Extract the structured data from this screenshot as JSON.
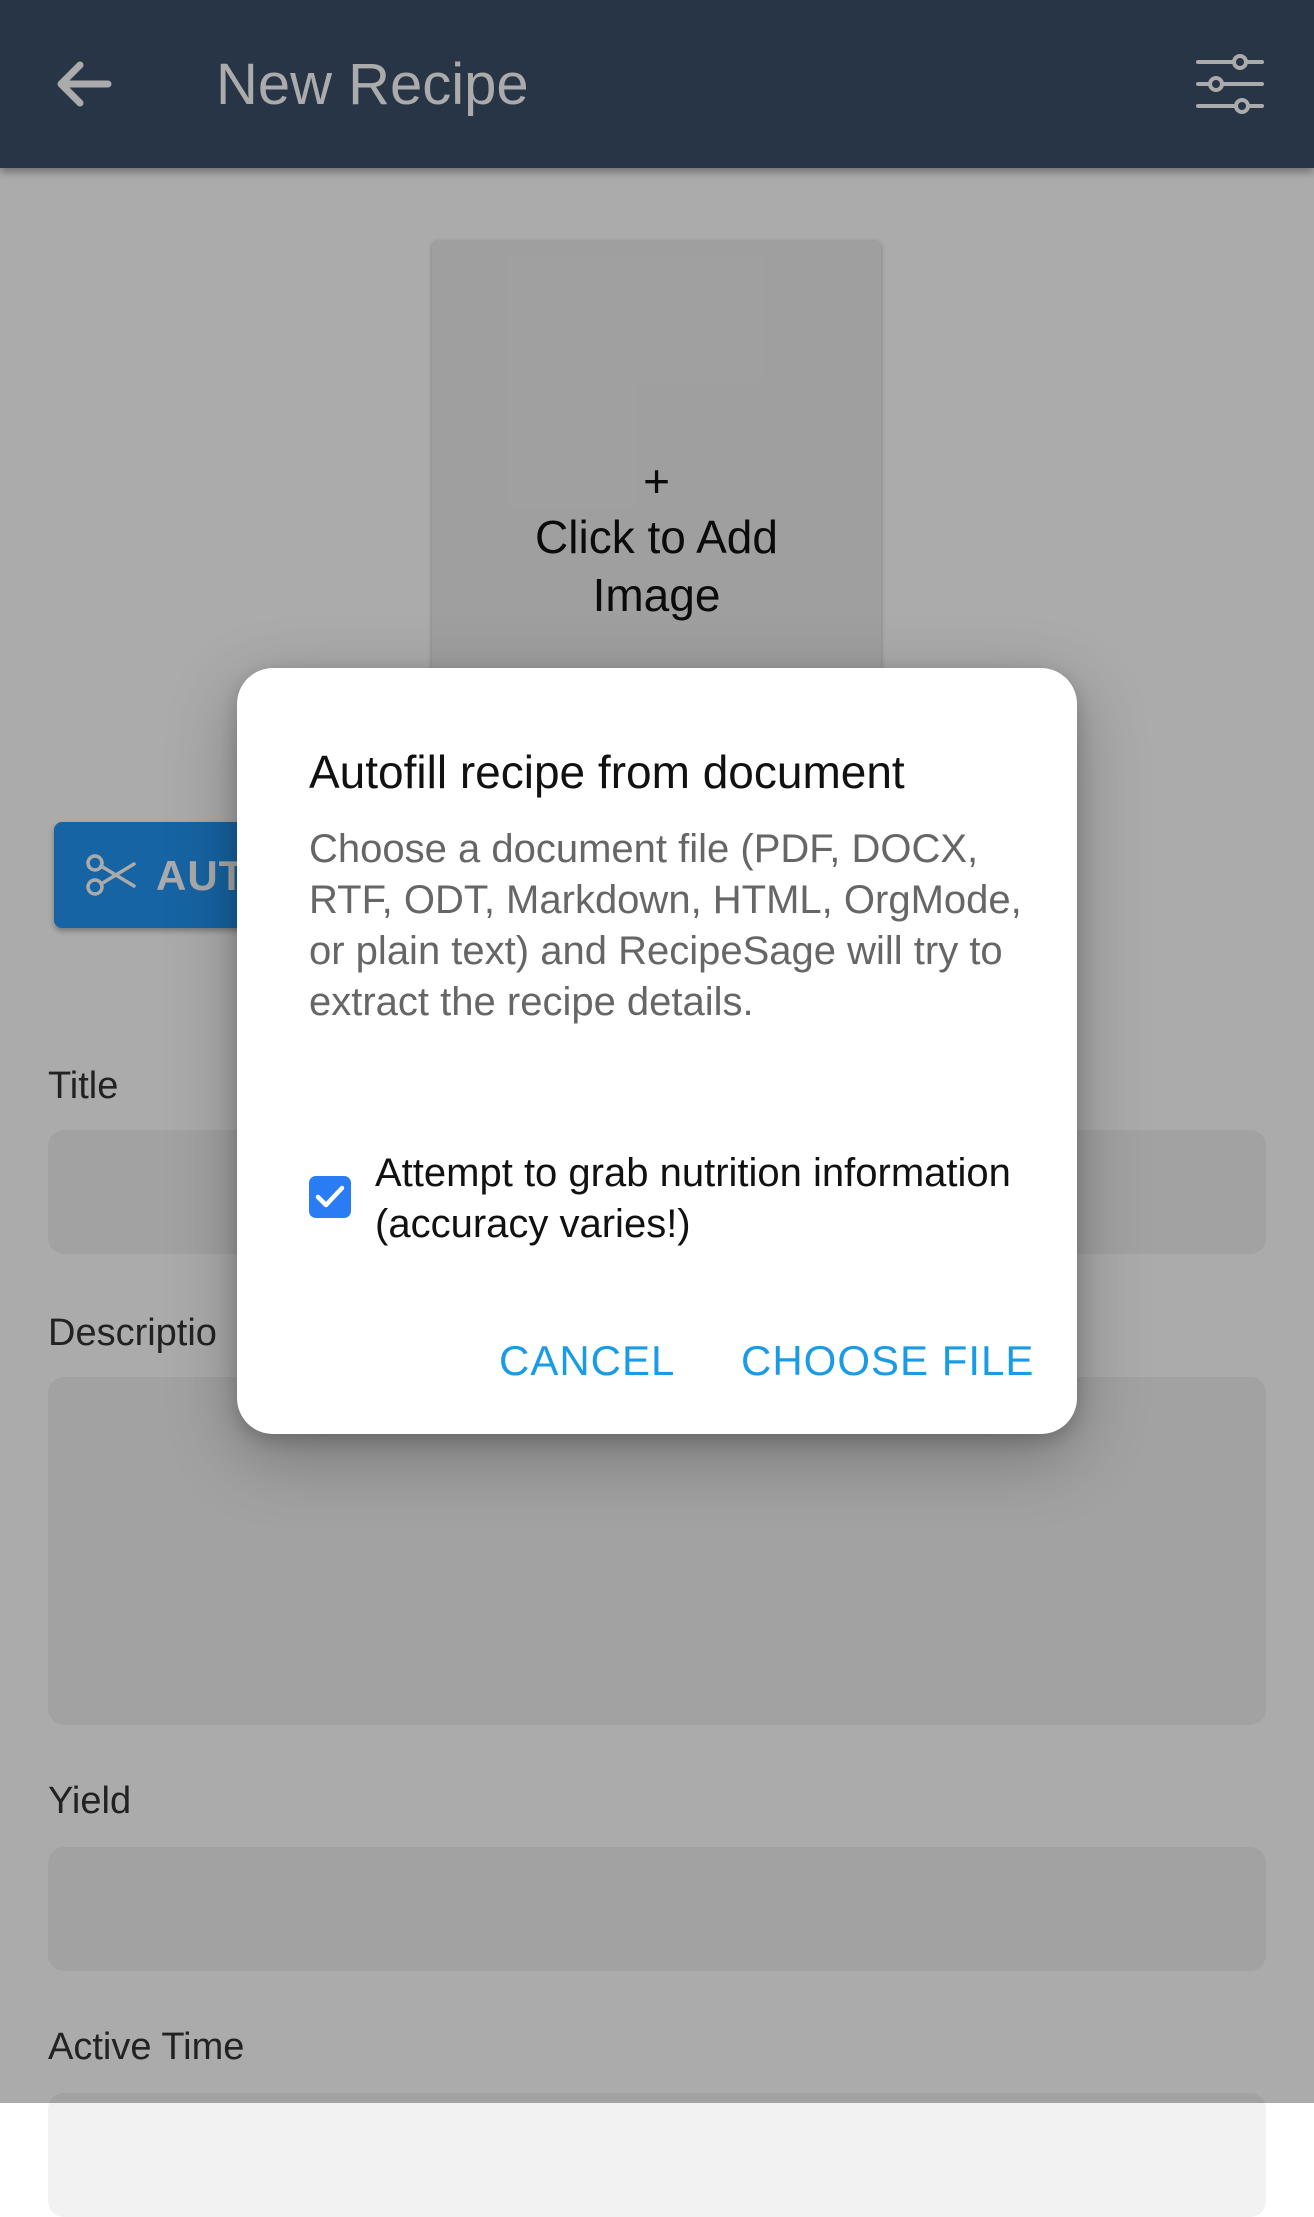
{
  "header": {
    "title": "New Recipe",
    "back_icon": "arrow-left-icon",
    "options_icon": "sliders-icon"
  },
  "image_uploader": {
    "plus": "+",
    "label": "Click to Add Image"
  },
  "autofill_button": {
    "label": "AUT",
    "icon": "scissors-icon"
  },
  "form": {
    "title_label": "Title",
    "description_label": "Descriptio",
    "yield_label": "Yield",
    "active_time_label": "Active Time"
  },
  "dialog": {
    "title": "Autofill recipe from document",
    "message": "Choose a document file (PDF, DOCX, RTF, ODT, Markdown, HTML, OrgMode, or plain text) and RecipeSage will try to extract the recipe details.",
    "checkbox_label": "Attempt to grab nutrition information (accuracy varies!)",
    "checkbox_checked": true,
    "cancel_label": "CANCEL",
    "choose_label": "CHOOSE FILE"
  },
  "colors": {
    "toolbar": "#3c4f6b",
    "primary": "#2196f3",
    "dialog_action": "#1a9be6",
    "checkbox": "#2a7cf5"
  }
}
